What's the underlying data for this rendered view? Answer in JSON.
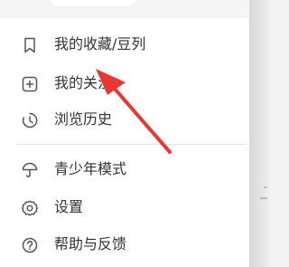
{
  "top_chip": {
    "text": "• • • • •"
  },
  "menu": {
    "items": [
      {
        "key": "favorites",
        "label": "我的收藏/豆列",
        "icon": "bookmark-icon"
      },
      {
        "key": "following",
        "label": "我的关注",
        "icon": "add-square-icon"
      },
      {
        "key": "history",
        "label": "浏览历史",
        "icon": "clock-icon"
      },
      {
        "key": "teen-mode",
        "label": "青少年模式",
        "icon": "umbrella-icon"
      },
      {
        "key": "settings",
        "label": "设置",
        "icon": "gear-icon"
      },
      {
        "key": "help",
        "label": "帮助与反馈",
        "icon": "question-circle-icon"
      }
    ]
  },
  "colors": {
    "text": "#333333",
    "icon": "#555555",
    "divider": "#e6e6e6",
    "arrow": "#e53935"
  }
}
